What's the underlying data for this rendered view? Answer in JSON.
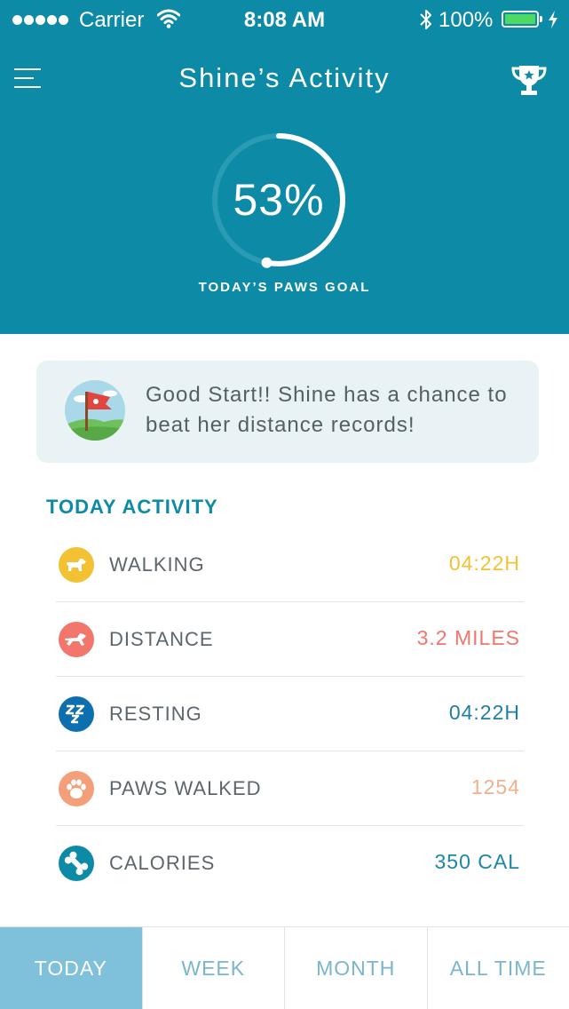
{
  "status_bar": {
    "carrier": "Carrier",
    "time": "8:08 AM",
    "battery": "100%"
  },
  "header": {
    "title": "Shine’s Activity",
    "goal_percent_text": "53%",
    "goal_progress": 0.53,
    "goal_label": "TODAY’S PAWS GOAL"
  },
  "message": {
    "text": "Good Start!! Shine has a chance to beat her distance records!"
  },
  "activity": {
    "title": "TODAY ACTIVITY",
    "items": [
      {
        "label": "WALKING",
        "value": "04:22H",
        "icon": "dog-walking-icon",
        "color": "#f2c134",
        "value_color": "#f2c134"
      },
      {
        "label": "DISTANCE",
        "value": "3.2 MILES",
        "icon": "dog-running-icon",
        "color": "#f2766b",
        "value_color": "#f2766b"
      },
      {
        "label": "RESTING",
        "value": "04:22H",
        "icon": "zzz-sleep-icon",
        "color": "#0e6fae",
        "value_color": "#1f7ea4"
      },
      {
        "label": "PAWS WALKED",
        "value": "1254",
        "icon": "paw-icon",
        "color": "#f3a07a",
        "value_color": "#f0b08e"
      },
      {
        "label": "CALORIES",
        "value": "350 CAL",
        "icon": "bone-icon",
        "color": "#0c8aa6",
        "value_color": "#1c87a8"
      }
    ]
  },
  "tabs": [
    {
      "label": "TODAY",
      "active": true
    },
    {
      "label": "WEEK",
      "active": false
    },
    {
      "label": "MONTH",
      "active": false
    },
    {
      "label": "ALL TIME",
      "active": false
    }
  ],
  "colors": {
    "brand": "#0c8aa6",
    "tab_active": "#7fc0da",
    "card": "#e9f2f5"
  }
}
